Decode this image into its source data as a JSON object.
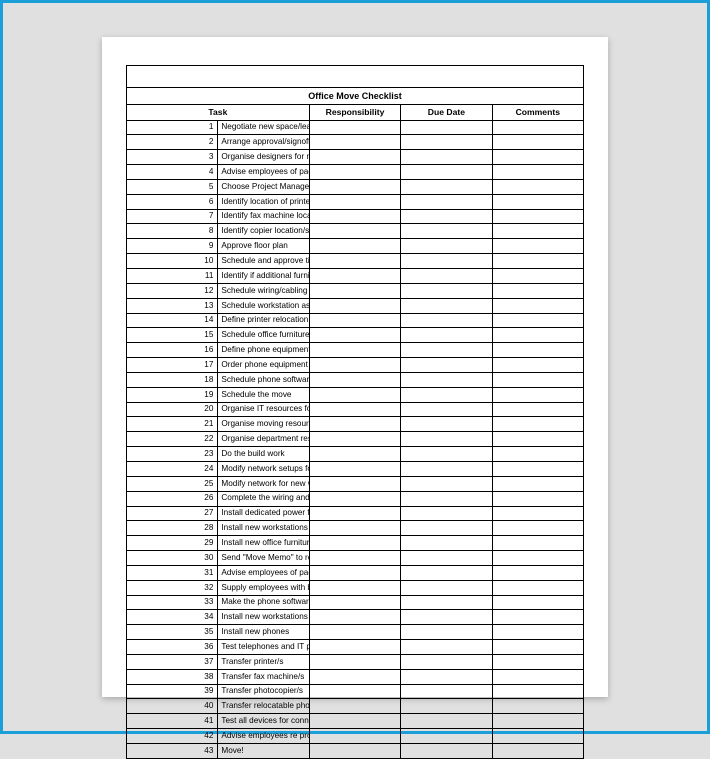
{
  "title": "Office Move Checklist",
  "headers": {
    "task": "Task",
    "responsibility": "Responsibility",
    "due_date": "Due Date",
    "comments": "Comments"
  },
  "rows": [
    {
      "num": "1",
      "task": "Negotiate new space/lease",
      "responsibility": "",
      "due_date": "",
      "comments": ""
    },
    {
      "num": "2",
      "task": "Arrange approval/signoff of new lease",
      "responsibility": "",
      "due_date": "",
      "comments": ""
    },
    {
      "num": "3",
      "task": "Organise designers for new floor plan design",
      "responsibility": "",
      "due_date": "",
      "comments": ""
    },
    {
      "num": "4",
      "task": "Advise employees of packing and moving schedule",
      "responsibility": "",
      "due_date": "",
      "comments": ""
    },
    {
      "num": "5",
      "task": "Choose Project Manager and contractors for build work",
      "responsibility": "",
      "due_date": "",
      "comments": ""
    },
    {
      "num": "6",
      "task": "Identify location of printers and workstations",
      "responsibility": "",
      "due_date": "",
      "comments": ""
    },
    {
      "num": "7",
      "task": "Identify fax machine location/s",
      "responsibility": "",
      "due_date": "",
      "comments": ""
    },
    {
      "num": "8",
      "task": "Identify copier location/s",
      "responsibility": "",
      "due_date": "",
      "comments": ""
    },
    {
      "num": "9",
      "task": "Approve floor plan",
      "responsibility": "",
      "due_date": "",
      "comments": ""
    },
    {
      "num": "10",
      "task": "Schedule and approve timeline",
      "responsibility": "",
      "due_date": "",
      "comments": ""
    },
    {
      "num": "11",
      "task": "Identify if additional furniture needs to be purchased",
      "responsibility": "",
      "due_date": "",
      "comments": ""
    },
    {
      "num": "12",
      "task": "Schedule wiring/cabling",
      "responsibility": "",
      "due_date": "",
      "comments": ""
    },
    {
      "num": "13",
      "task": "Schedule workstation assembly",
      "responsibility": "",
      "due_date": "",
      "comments": ""
    },
    {
      "num": "14",
      "task": "Define printer relocation requirements",
      "responsibility": "",
      "due_date": "",
      "comments": ""
    },
    {
      "num": "15",
      "task": "Schedule office furniture delivery",
      "responsibility": "",
      "due_date": "",
      "comments": ""
    },
    {
      "num": "16",
      "task": "Define phone equipment requirements",
      "responsibility": "",
      "due_date": "",
      "comments": ""
    },
    {
      "num": "17",
      "task": "Order phone equipment upgrade (if any)",
      "responsibility": "",
      "due_date": "",
      "comments": ""
    },
    {
      "num": "18",
      "task": "Schedule phone software changes",
      "responsibility": "",
      "due_date": "",
      "comments": ""
    },
    {
      "num": "19",
      "task": "Schedule the move",
      "responsibility": "",
      "due_date": "",
      "comments": ""
    },
    {
      "num": "20",
      "task": "Organise IT resources for the move",
      "responsibility": "",
      "due_date": "",
      "comments": ""
    },
    {
      "num": "21",
      "task": "Organise moving resources (external and internal)",
      "responsibility": "",
      "due_date": "",
      "comments": ""
    },
    {
      "num": "22",
      "task": "Organise department resources for the move",
      "responsibility": "",
      "due_date": "",
      "comments": ""
    },
    {
      "num": "23",
      "task": "Do the build work",
      "responsibility": "",
      "due_date": "",
      "comments": ""
    },
    {
      "num": "24",
      "task": "Modify network setups for new printers",
      "responsibility": "",
      "due_date": "",
      "comments": ""
    },
    {
      "num": "25",
      "task": "Modify network for new workstations",
      "responsibility": "",
      "due_date": "",
      "comments": ""
    },
    {
      "num": "26",
      "task": "Complete the wiring and cabling",
      "responsibility": "",
      "due_date": "",
      "comments": ""
    },
    {
      "num": "27",
      "task": "Install dedicated power for copiers",
      "responsibility": "",
      "due_date": "",
      "comments": ""
    },
    {
      "num": "28",
      "task": "Install new workstations",
      "responsibility": "",
      "due_date": "",
      "comments": ""
    },
    {
      "num": "29",
      "task": "Install new office furniture",
      "responsibility": "",
      "due_date": "",
      "comments": ""
    },
    {
      "num": "30",
      "task": "Send \"Move Memo\" to relocating employees",
      "responsibility": "",
      "due_date": "",
      "comments": ""
    },
    {
      "num": "31",
      "task": "Advise employees of packing and moving schedule",
      "responsibility": "",
      "due_date": "",
      "comments": ""
    },
    {
      "num": "32",
      "task": "Supply employees with boxes",
      "responsibility": "",
      "due_date": "",
      "comments": ""
    },
    {
      "num": "33",
      "task": "Make the phone software setup changes",
      "responsibility": "",
      "due_date": "",
      "comments": ""
    },
    {
      "num": "34",
      "task": "Install new workstations",
      "responsibility": "",
      "due_date": "",
      "comments": ""
    },
    {
      "num": "35",
      "task": "Install new phones",
      "responsibility": "",
      "due_date": "",
      "comments": ""
    },
    {
      "num": "36",
      "task": "Test telephones and IT points",
      "responsibility": "",
      "due_date": "",
      "comments": ""
    },
    {
      "num": "37",
      "task": "Transfer printer/s",
      "responsibility": "",
      "due_date": "",
      "comments": ""
    },
    {
      "num": "38",
      "task": "Transfer fax machine/s",
      "responsibility": "",
      "due_date": "",
      "comments": ""
    },
    {
      "num": "39",
      "task": "Transfer photocopier/s",
      "responsibility": "",
      "due_date": "",
      "comments": ""
    },
    {
      "num": "40",
      "task": "Transfer relocatable phone handsets",
      "responsibility": "",
      "due_date": "",
      "comments": ""
    },
    {
      "num": "41",
      "task": "Test all devices for connectivity",
      "responsibility": "",
      "due_date": "",
      "comments": ""
    },
    {
      "num": "42",
      "task": "Advise employees re procedure for empty boxes",
      "responsibility": "",
      "due_date": "",
      "comments": ""
    },
    {
      "num": "43",
      "task": "Move!",
      "responsibility": "",
      "due_date": "",
      "comments": ""
    }
  ]
}
